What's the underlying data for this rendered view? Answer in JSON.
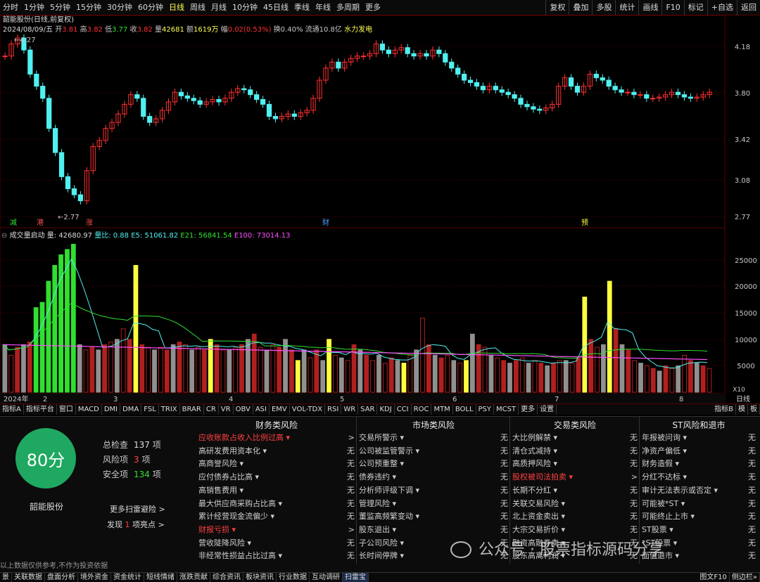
{
  "period_tabs": [
    "分时",
    "1分钟",
    "5分钟",
    "15分钟",
    "30分钟",
    "60分钟",
    "日线",
    "周线",
    "月线",
    "10分钟",
    "45日线",
    "季线",
    "年线",
    "多周期",
    "更多"
  ],
  "active_tab": "日线",
  "right_tools": [
    "复权",
    "叠加",
    "多股",
    "统计",
    "画线",
    "F10",
    "标记",
    "+自选",
    "返回"
  ],
  "stock_title": "韶能股份(日线,前复权)",
  "info_line": {
    "date": "2024/08/09/五",
    "open_label": "开",
    "open": "3.81",
    "high_label": "高",
    "high": "3.82",
    "low_label": "低",
    "low": "3.77",
    "close_label": "收",
    "close": "3.82",
    "vol_label": "量",
    "vol": "42681",
    "amt_label": "额",
    "amt": "1619万",
    "chg_label": "幅",
    "chg": "0.02(0.53%)",
    "turnover": "换0.40%",
    "float": "流通10.8亿",
    "sector": "水力发电"
  },
  "price_axis": [
    "4.18",
    "3.80",
    "3.42",
    "3.08",
    "2.77"
  ],
  "price_high_label": "4.27",
  "price_low_label": "2.77",
  "event_marks": [
    "减",
    "港",
    "涨",
    "财",
    "预"
  ],
  "volume_header": {
    "name": "成交量启动",
    "vol": "量: 42680.97",
    "ratio": "量比: 0.88",
    "e5": "E5: 51061.82",
    "e21": "E21: 56841.54",
    "e100": "E100: 73014.13"
  },
  "volume_axis": [
    "25000",
    "20000",
    "15000",
    "10000",
    "5000"
  ],
  "volume_unit": "X10",
  "month_labels": [
    "2024年",
    "2",
    "3",
    "4",
    "5",
    "6",
    "7",
    "8"
  ],
  "timeframe_label": "日线",
  "indicator_tabs": [
    "指标A",
    "指标平台",
    "窗口",
    "MACD",
    "DMI",
    "DMA",
    "FSL",
    "TRIX",
    "BRAR",
    "CR",
    "VR",
    "OBV",
    "ASI",
    "EMV",
    "VOL-TDX",
    "RSI",
    "WR",
    "SAR",
    "KDJ",
    "CCI",
    "ROC",
    "MTM",
    "BOLL",
    "PSY",
    "MCST",
    "更多",
    "设置"
  ],
  "indicator_tabs_right": [
    "指标B",
    "模",
    "板"
  ],
  "score": {
    "value": "80分",
    "stock": "韶能股份"
  },
  "stats": [
    {
      "label": "总检查",
      "num": "137",
      "unit": "项"
    },
    {
      "label": "风险项",
      "num": "3",
      "unit": "项"
    },
    {
      "label": "安全项",
      "num": "134",
      "unit": "项"
    }
  ],
  "more_scan": "更多扫雷避险 >",
  "highlight": {
    "pre": "发现",
    "num": "1",
    "post": "项亮点 >"
  },
  "disclaimer": "以上数据仅供参考,不作为投资依据",
  "columns": [
    {
      "title": "财务类风险",
      "rows": [
        {
          "l": "应收账款占收入比例过高",
          "r": ">",
          "red": true
        },
        {
          "l": "高研发费用资本化",
          "r": "无"
        },
        {
          "l": "高商誉风险",
          "r": "无"
        },
        {
          "l": "应付债券占比高",
          "r": "无"
        },
        {
          "l": "高销售费用",
          "r": "无"
        },
        {
          "l": "最大供应商采购占比高",
          "r": "无"
        },
        {
          "l": "累计经营现金流偏少",
          "r": "无"
        },
        {
          "l": "财报亏损",
          "r": ">",
          "red": true
        },
        {
          "l": "营收陡降风险",
          "r": "无"
        },
        {
          "l": "非经常性损益占比过高",
          "r": "无"
        }
      ]
    },
    {
      "title": "市场类风险",
      "rows": [
        {
          "l": "交易所警示",
          "r": "无"
        },
        {
          "l": "公司被监管警示",
          "r": "无"
        },
        {
          "l": "公司预重整",
          "r": "无"
        },
        {
          "l": "债券违约",
          "r": "无"
        },
        {
          "l": "分析师评级下调",
          "r": "无"
        },
        {
          "l": "管理风险",
          "r": "无"
        },
        {
          "l": "董监高频繁变动",
          "r": "无"
        },
        {
          "l": "股东退出",
          "r": "无"
        },
        {
          "l": "子公司风险",
          "r": "无"
        },
        {
          "l": "长时间停牌",
          "r": "无"
        }
      ]
    },
    {
      "title": "交易类风险",
      "rows": [
        {
          "l": "大比例解禁",
          "r": "无"
        },
        {
          "l": "清仓式减持",
          "r": "无"
        },
        {
          "l": "高质押风险",
          "r": "无"
        },
        {
          "l": "股权被司法拍卖",
          "r": ">",
          "red": true
        },
        {
          "l": "长期不分红",
          "r": "无"
        },
        {
          "l": "关联交易风险",
          "r": "无"
        },
        {
          "l": "北上资金卖出",
          "r": "无"
        },
        {
          "l": "大宗交易折价",
          "r": "无"
        },
        {
          "l": "融资高融券卖",
          "r": "无"
        },
        {
          "l": "股东高离利润",
          "r": "无"
        }
      ]
    },
    {
      "title": "ST风险和退市",
      "rows": [
        {
          "l": "年报被问询",
          "r": "无"
        },
        {
          "l": "净资产偏低",
          "r": "无"
        },
        {
          "l": "财务造假",
          "r": "无"
        },
        {
          "l": "分红不达标",
          "r": "无"
        },
        {
          "l": "审计无法表示或否定",
          "r": "无"
        },
        {
          "l": "可能被*ST",
          "r": "无"
        },
        {
          "l": "可能终止上市",
          "r": "无"
        },
        {
          "l": "ST股票",
          "r": "无"
        },
        {
          "l": "*ST股票",
          "r": "无"
        },
        {
          "l": "面值退市",
          "r": "无"
        }
      ]
    }
  ],
  "bottom_tabs": [
    "景",
    "关联数据",
    "盘面分析",
    "境外资金",
    "资金统计",
    "短线情绪",
    "涨跌贡献",
    "综合资讯",
    "板块资讯",
    "行业数据",
    "互动调研",
    "扫雷宝"
  ],
  "bottom_active": "扫雷宝",
  "bottom_right": [
    "图文F10",
    "侧边栏»"
  ],
  "watermark": "公众号 · 股票指标源码分享",
  "colors": {
    "up": "#ff3030",
    "down": "#50f0f0",
    "vol_green": "#30e030",
    "vol_yellow": "#ffff40",
    "vol_gray": "#909090",
    "vol_red": "#b02020",
    "accent_red": "#a00000",
    "score_green": "#1fa861"
  }
}
